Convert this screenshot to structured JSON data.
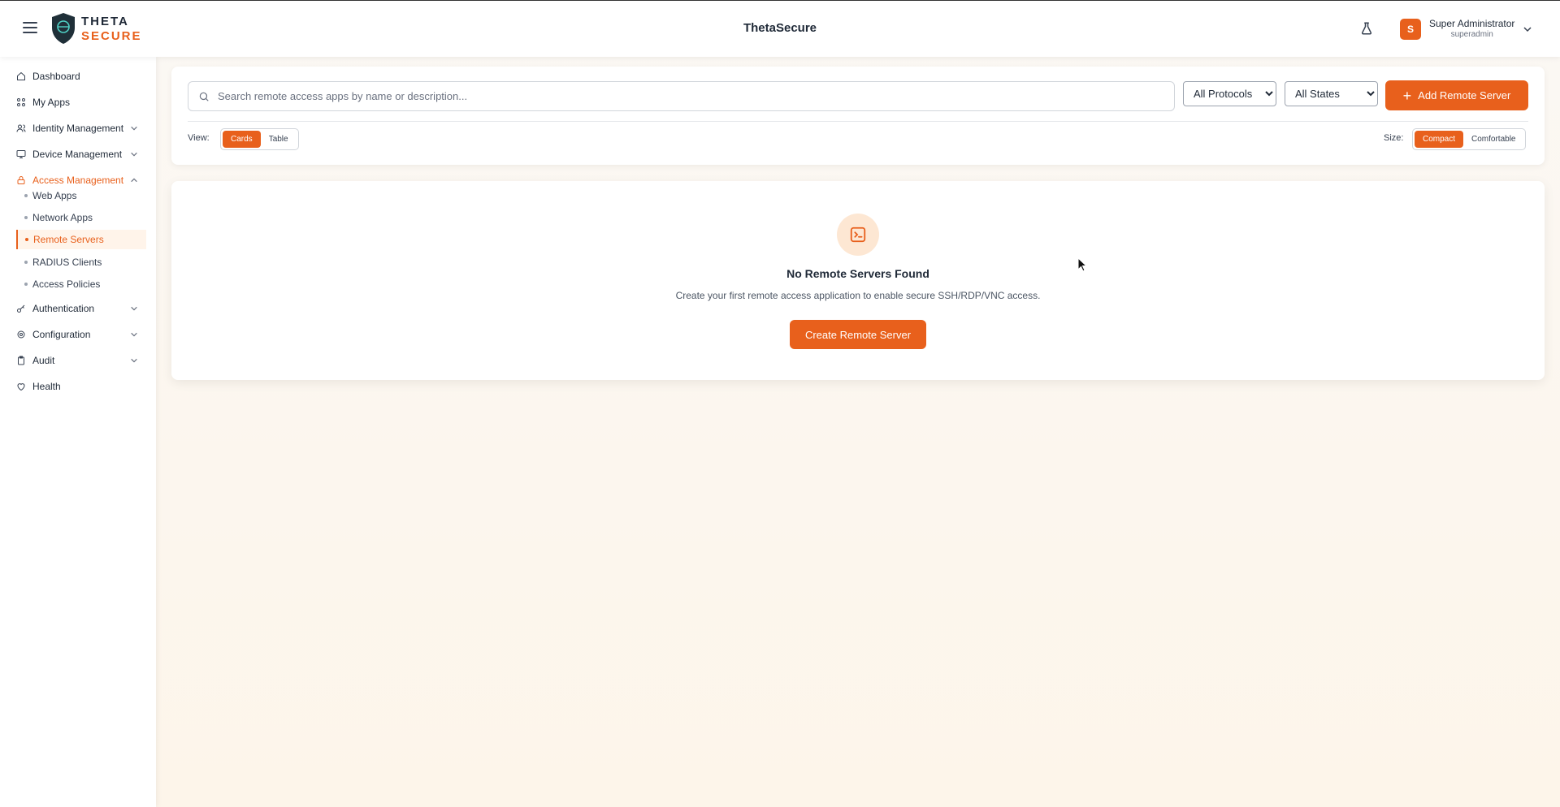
{
  "header": {
    "logo_line1": "THETA",
    "logo_line2": "SECURE",
    "app_title": "ThetaSecure",
    "user": {
      "avatar_letter": "S",
      "name": "Super Administrator",
      "handle": "superadmin"
    }
  },
  "sidebar": {
    "items": [
      {
        "label": "Dashboard",
        "icon": "home-icon"
      },
      {
        "label": "My Apps",
        "icon": "grid-icon"
      },
      {
        "label": "Identity Management",
        "icon": "users-icon"
      },
      {
        "label": "Device Management",
        "icon": "monitor-icon"
      },
      {
        "label": "Access Management",
        "icon": "lock-icon"
      },
      {
        "label": "Authentication",
        "icon": "key-icon"
      },
      {
        "label": "Configuration",
        "icon": "gear-icon"
      },
      {
        "label": "Audit",
        "icon": "clipboard-icon"
      },
      {
        "label": "Health",
        "icon": "heart-icon"
      }
    ],
    "access_sub": [
      "Web Apps",
      "Network Apps",
      "Remote Servers",
      "RADIUS Clients",
      "Access Policies"
    ]
  },
  "toolbar": {
    "search_placeholder": "Search remote access apps by name or description...",
    "protocol_selected": "All Protocols",
    "state_selected": "All States",
    "add_label": "Add Remote Server",
    "view_label": "View:",
    "view_options": [
      "Cards",
      "Table"
    ],
    "size_label": "Size:",
    "size_options": [
      "Compact",
      "Comfortable"
    ]
  },
  "empty_state": {
    "title": "No Remote Servers Found",
    "description": "Create your first remote access application to enable secure SSH/RDP/VNC access.",
    "button": "Create Remote Server"
  },
  "colors": {
    "accent": "#e8601c",
    "accent_soft": "#fde7d3"
  }
}
